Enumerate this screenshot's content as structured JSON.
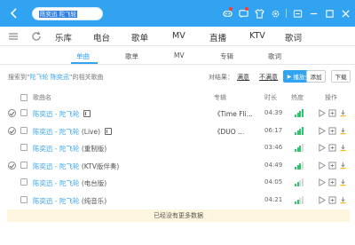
{
  "search": {
    "query": "陈奕迅 陀飞轮"
  },
  "main_tabs": [
    "乐库",
    "电台",
    "歌单",
    "MV",
    "直播",
    "KTV",
    "歌词"
  ],
  "sub_tabs": [
    "单曲",
    "歌单",
    "MV",
    "专辑",
    "歌词"
  ],
  "info": {
    "prefix": "搜索到“",
    "keyword": "陀飞轮 陈奕迅",
    "suffix": "”的相关歌曲",
    "compare_label": "对结果：",
    "compare_satisfied": "满意",
    "compare_unsatisfied": "不满意",
    "play_all": "播放全部",
    "add": "添加",
    "download": "下载"
  },
  "table_header": {
    "name": "歌曲名",
    "album": "专辑",
    "duration": "时长",
    "heat": "热度",
    "ops": "操作"
  },
  "songs": [
    {
      "name": "陈奕迅 - 陀飞轮",
      "sub": "",
      "mv": true,
      "album": "《Time Fli...",
      "duration": "04:39",
      "heat": 4,
      "circle": true
    },
    {
      "name": "陈奕迅 - 陀飞轮",
      "sub": " (Live)",
      "mv": true,
      "album": "《DUO ...",
      "duration": "06:17",
      "heat": 4,
      "circle": true
    },
    {
      "name": "陈奕迅 - 陀飞轮",
      "sub": "  (重制版)",
      "mv": false,
      "album": "",
      "duration": "03:46",
      "heat": 3,
      "circle": false
    },
    {
      "name": "陈奕迅 - 陀飞轮",
      "sub": " (KTV版伴奏)",
      "mv": false,
      "album": "",
      "duration": "04:49",
      "heat": 3,
      "circle": true
    },
    {
      "name": "陈奕迅 - 陀飞轮",
      "sub": "  (电台版)",
      "mv": false,
      "album": "",
      "duration": "04:05",
      "heat": 2,
      "circle": false
    },
    {
      "name": "陈奕迅 - 陀飞轮",
      "sub": "  (纯音乐)",
      "mv": false,
      "album": "",
      "duration": "04:21",
      "heat": 2,
      "circle": false
    }
  ],
  "footer": "已经没有更多数据",
  "colors": {
    "accent": "#31a3f0",
    "heat": "#2ec46c",
    "footer_bg": "#fdf5de"
  },
  "icons": [
    "back-icon",
    "search-icon",
    "game-icon",
    "message-icon",
    "skin-icon",
    "settings-icon",
    "minimize-icon",
    "maximize-icon",
    "close-icon",
    "list-icon",
    "refresh-icon",
    "play-icon",
    "add-icon",
    "download-icon"
  ]
}
